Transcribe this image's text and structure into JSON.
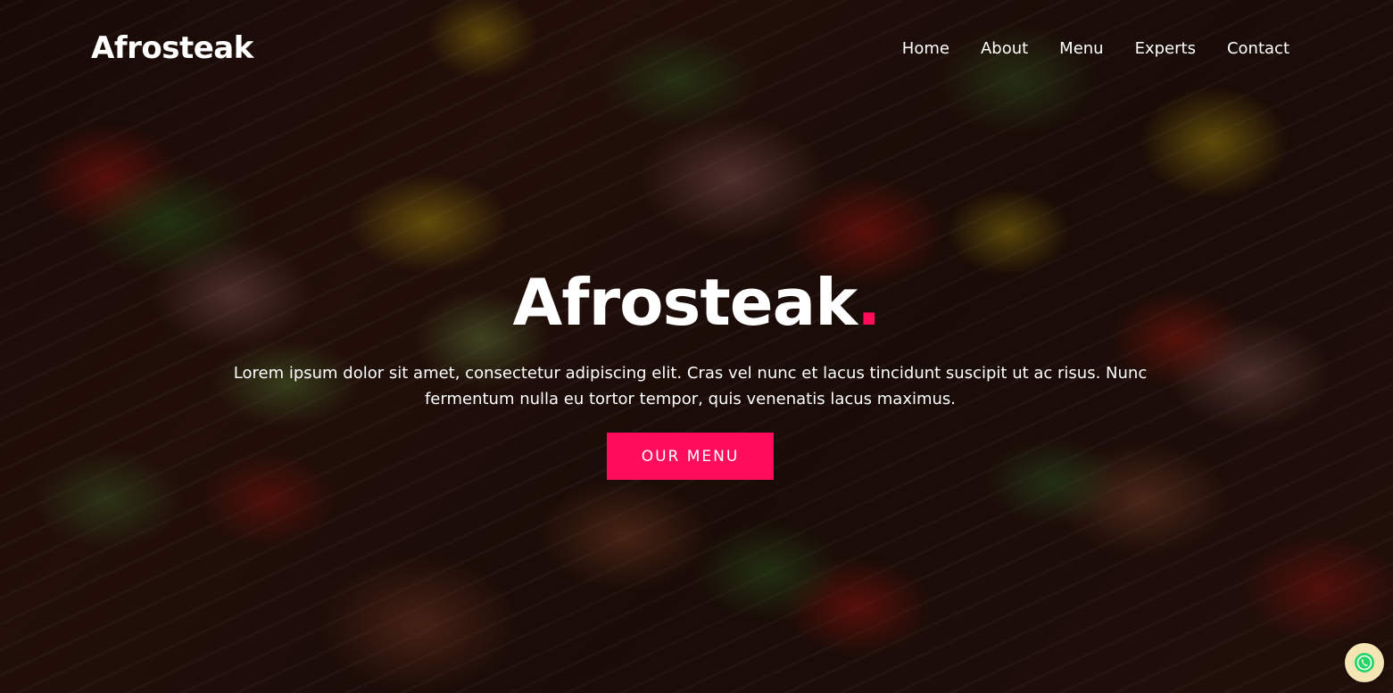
{
  "header": {
    "brand": "Afrosteak",
    "nav": [
      {
        "label": "Home"
      },
      {
        "label": "About"
      },
      {
        "label": "Menu"
      },
      {
        "label": "Experts"
      },
      {
        "label": "Contact"
      }
    ]
  },
  "hero": {
    "title": "Afrosteak",
    "title_dot": ".",
    "description": "Lorem ipsum dolor sit amet, consectetur adipiscing elit. Cras vel nunc et lacus tincidunt suscipit ut ac risus. Nunc fermentum nulla eu tortor tempor, quis venenatis lacus maximus.",
    "cta_label": "OUR MENU"
  },
  "floating_widget": {
    "icon": "whatsapp-icon"
  },
  "colors": {
    "accent": "#ff0c5c",
    "text": "#ffffff",
    "widget_bg": "#f6e5b4",
    "whatsapp_green": "#25d366"
  }
}
